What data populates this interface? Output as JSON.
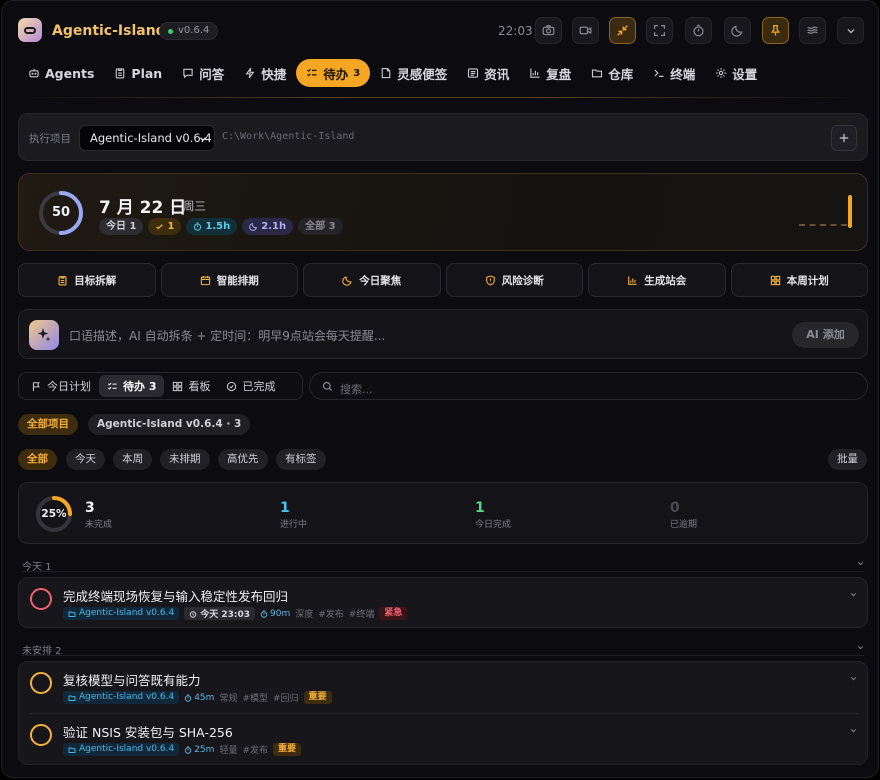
{
  "header": {
    "app_title": "Agentic-Island",
    "version": "v0.6.4",
    "time": "22:03"
  },
  "nav": {
    "items": [
      {
        "label": "Agents",
        "icon": "robot-icon"
      },
      {
        "label": "Plan",
        "icon": "clipboard-icon"
      },
      {
        "label": "问答",
        "icon": "chat-icon"
      },
      {
        "label": "快捷",
        "icon": "bolt-icon"
      },
      {
        "label": "待办",
        "icon": "list-check-icon",
        "badge": "3",
        "active": true
      },
      {
        "label": "灵感便签",
        "icon": "note-icon"
      },
      {
        "label": "资讯",
        "icon": "news-icon"
      },
      {
        "label": "复盘",
        "icon": "bar-chart-icon"
      },
      {
        "label": "仓库",
        "icon": "folder-icon"
      },
      {
        "label": "终端",
        "icon": "terminal-icon"
      },
      {
        "label": "设置",
        "icon": "gear-icon"
      }
    ]
  },
  "project": {
    "label": "执行项目",
    "selected": "Agentic-Island v0.6.4",
    "path": "C:\\Work\\Agentic-Island"
  },
  "today": {
    "progress": 50,
    "date": "7 月 22 日",
    "weekday": "周三",
    "chips": {
      "today": "今日 1",
      "done": "1",
      "focus": "1.5h",
      "rest": "2.1h",
      "all": "全部 3"
    }
  },
  "actions": [
    {
      "label": "目标拆解",
      "icon": "clipboard-list-icon"
    },
    {
      "label": "智能排期",
      "icon": "calendar-icon"
    },
    {
      "label": "今日聚焦",
      "icon": "moon-icon"
    },
    {
      "label": "风险诊断",
      "icon": "shield-icon"
    },
    {
      "label": "生成站会",
      "icon": "bar-chart-icon"
    },
    {
      "label": "本周计划",
      "icon": "grid-icon"
    }
  ],
  "ai": {
    "placeholder": "口语描述，AI 自动拆条 + 定时间：明早9点站会每天提醒...",
    "button": "AI 添加"
  },
  "view_tabs": [
    {
      "label": "今日计划",
      "icon": "flag-icon"
    },
    {
      "label": "待办 3",
      "icon": "list-check-icon",
      "active": true
    },
    {
      "label": "看板",
      "icon": "grid-icon"
    },
    {
      "label": "已完成",
      "icon": "check-circle-icon"
    }
  ],
  "search": {
    "placeholder": "搜索..."
  },
  "project_filters": [
    "全部项目",
    "Agentic-Island v0.6.4 · 3"
  ],
  "time_filters": [
    "全部",
    "今天",
    "本周",
    "未排期",
    "高优先",
    "有标签"
  ],
  "batch": "批量",
  "stats": {
    "percent": 25,
    "percent_label": "25%",
    "items": [
      {
        "value": "3",
        "label": "未完成",
        "color": "#f2f2f5"
      },
      {
        "value": "1",
        "label": "进行中",
        "color": "#4cc3ea"
      },
      {
        "value": "1",
        "label": "今日完成",
        "color": "#57d38c"
      },
      {
        "value": "0",
        "label": "已逾期",
        "color": "#4a4a52"
      }
    ]
  },
  "sections": [
    {
      "label": "今天 1",
      "tasks": [
        {
          "title": "完成终端现场恢复与输入稳定性发布回归",
          "project": "Agentic-Island v0.6.4",
          "time": "今天 23:03",
          "duration": "90m",
          "mode": "深度",
          "tags": [
            "#发布",
            "#终端"
          ],
          "priority": "紧急",
          "circle_color": "#f06070"
        }
      ]
    },
    {
      "label": "未安排 2",
      "tasks": [
        {
          "title": "复核模型与问答既有能力",
          "project": "Agentic-Island v0.6.4",
          "duration": "45m",
          "mode": "常规",
          "tags": [
            "#模型",
            "#回归"
          ],
          "priority": "重要",
          "circle_color": "#f5b13a"
        },
        {
          "title": "验证 NSIS 安装包与 SHA-256",
          "project": "Agentic-Island v0.6.4",
          "duration": "25m",
          "mode": "轻量",
          "tags": [
            "#发布"
          ],
          "priority": "重要",
          "circle_color": "#f5b13a"
        }
      ]
    }
  ]
}
